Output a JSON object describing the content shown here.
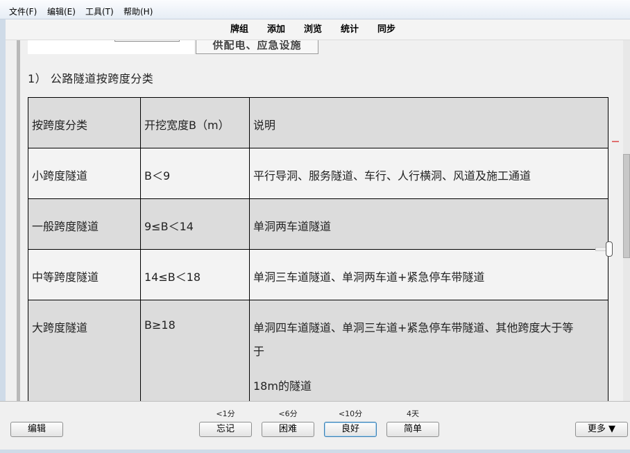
{
  "menu": {
    "file": "文件(F)",
    "edit": "编辑(E)",
    "tools": "工具(T)",
    "help": "帮助(H)"
  },
  "toolbar": {
    "deck": "牌组",
    "add": "添加",
    "browse": "浏览",
    "stats": "统计",
    "sync": "同步"
  },
  "card": {
    "image_label": "供配电、应急设施",
    "heading": "1） 公路隧道按跨度分类",
    "table": {
      "headers": [
        "按跨度分类",
        "开挖宽度B（m）",
        "说明"
      ],
      "rows": [
        {
          "category": "小跨度隧道",
          "width": "B＜9",
          "desc": "平行导洞、服务隧道、车行、人行横洞、风道及施工通道"
        },
        {
          "category": "一般跨度隧道",
          "width": "9≤B＜14",
          "desc": "单洞两车道隧道"
        },
        {
          "category": "中等跨度隧道",
          "width": "14≤B＜18",
          "desc": "单洞三车道隧道、单洞两车道+紧急停车带隧道"
        },
        {
          "category": "大跨度隧道",
          "width": "B≥18",
          "desc_line1": "单洞四车道隧道、单洞三车道+紧急停车带隧道、其他跨度大于等",
          "desc_line2": "于",
          "desc_line3": "18m的隧道"
        }
      ]
    }
  },
  "bottom": {
    "edit": "编辑",
    "more": "更多 ▼",
    "answers": [
      {
        "interval": "<1分",
        "label": "忘记"
      },
      {
        "interval": "<6分",
        "label": "困难"
      },
      {
        "interval": "<10分",
        "label": "良好"
      },
      {
        "interval": "4天",
        "label": "简单"
      }
    ]
  }
}
